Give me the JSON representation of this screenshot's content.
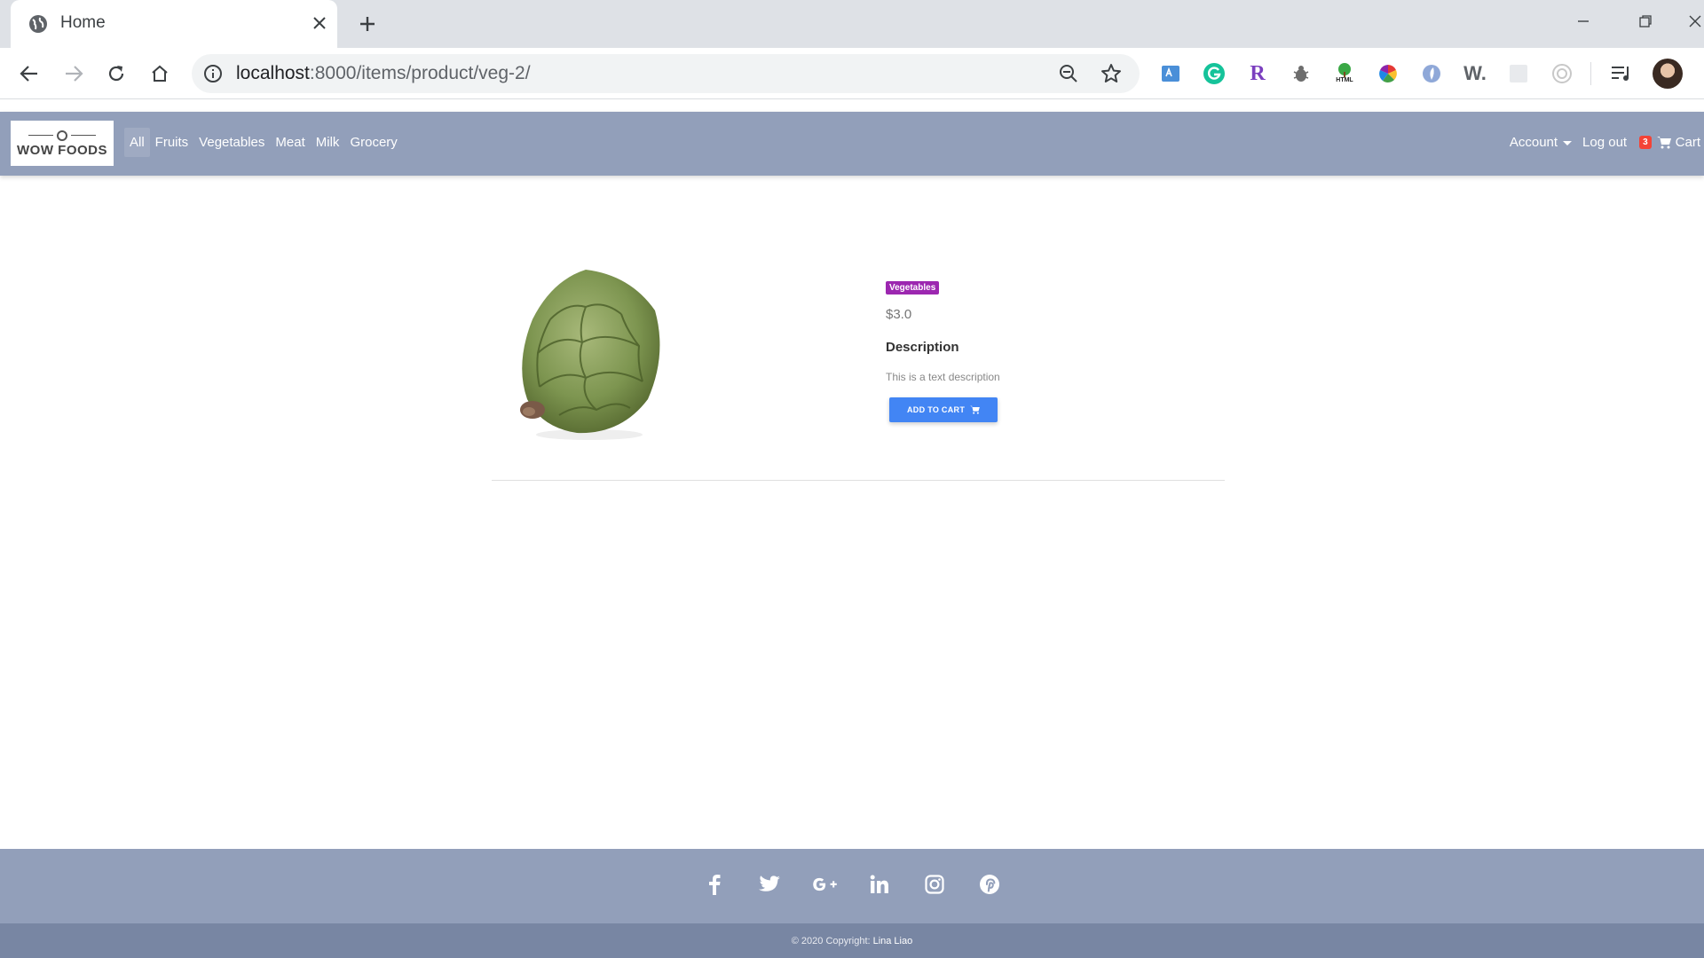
{
  "browser": {
    "tab_title": "Home",
    "url_host": "localhost",
    "url_rest": ":8000/items/product/veg-2/",
    "extensions": [
      "translate-icon",
      "grammarly-icon",
      "r-extension-icon",
      "bug-icon",
      "html-tree-icon",
      "color-wheel-icon",
      "shield-icon",
      "w-extension-icon",
      "blank-extension-icon",
      "target-extension-icon",
      "media-control-icon"
    ],
    "ext_r_label": "R",
    "ext_w_label": "W.",
    "ext_g_label": "G",
    "html_label": "HTML"
  },
  "navbar": {
    "logo_text": "WOW FOODS",
    "links": [
      "All",
      "Fruits",
      "Vegetables",
      "Meat",
      "Milk",
      "Grocery"
    ],
    "account_label": "Account",
    "logout_label": "Log out",
    "cart_count": "3",
    "cart_label": "Cart"
  },
  "product": {
    "category": "Vegetables",
    "price": "$3.0",
    "description_title": "Description",
    "description": "This is a text description",
    "add_to_cart_label": "ADD TO CART"
  },
  "footer": {
    "social": [
      "facebook-icon",
      "twitter-icon",
      "google-plus-icon",
      "linkedin-icon",
      "instagram-icon",
      "pinterest-icon"
    ],
    "copyright": "© 2020 Copyright:",
    "author": "Lina Liao"
  },
  "colors": {
    "navbar_bg": "#929fba",
    "footer_bottom_bg": "#7886a3",
    "badge_purple": "#9c27b0",
    "button_blue": "#4285f4",
    "cart_badge_red": "#f44336"
  }
}
